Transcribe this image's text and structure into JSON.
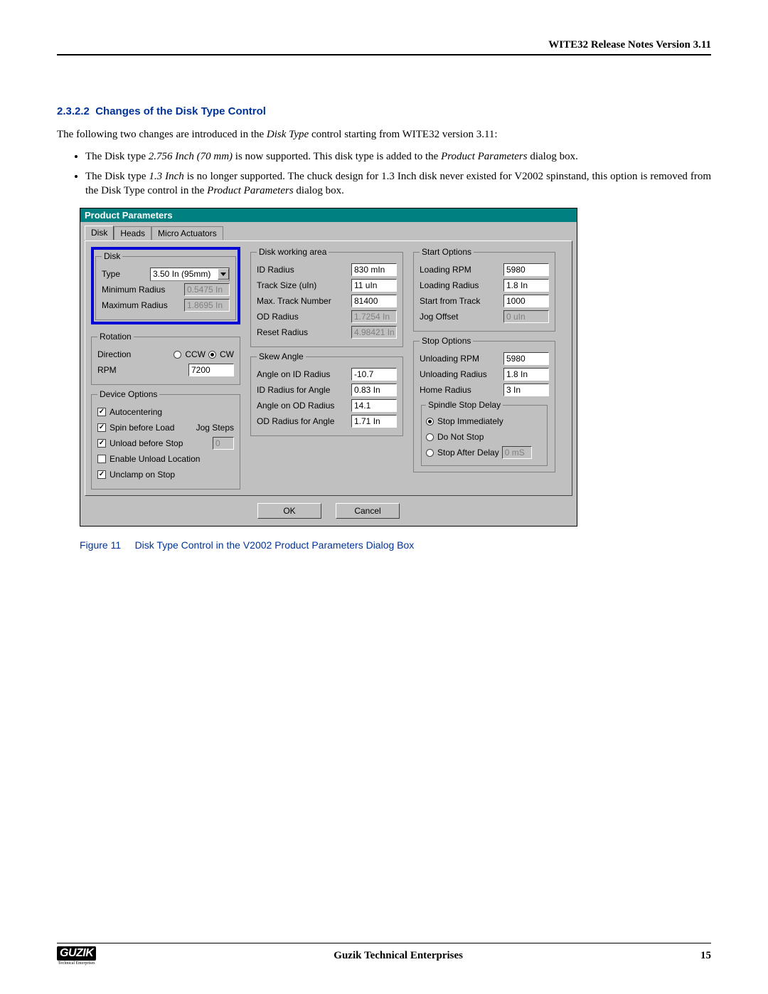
{
  "header": {
    "title": "WITE32 Release Notes Version 3.11"
  },
  "section": {
    "number": "2.3.2.2",
    "title": "Changes of the Disk Type Control",
    "intro_pre": "The following two changes are introduced in the ",
    "intro_em": "Disk Type",
    "intro_post": " control starting from WITE32 version 3.11:",
    "bullet1_a": "The Disk type ",
    "bullet1_em": "2.756 Inch (70 mm)",
    "bullet1_b": " is now supported. This disk type is added to the ",
    "bullet1_em2": "Product Parameters",
    "bullet1_c": " dialog box.",
    "bullet2_a": "The Disk type ",
    "bullet2_em": "1.3 Inch",
    "bullet2_b": " is no longer supported. The chuck design for 1.3 Inch disk never existed for V2002 spinstand, this option is removed from the Disk Type control in the ",
    "bullet2_em2": "Product Parameters",
    "bullet2_c": " dialog box."
  },
  "dialog": {
    "title": "Product Parameters",
    "tabs": {
      "t0": "Disk",
      "t1": "Heads",
      "t2": "Micro Actuators"
    },
    "disk": {
      "legend": "Disk",
      "type_label": "Type",
      "type_value": "3.50 In (95mm)",
      "minr_label": "Minimum Radius",
      "minr_value": "0.5475 In",
      "maxr_label": "Maximum Radius",
      "maxr_value": "1.8695 In"
    },
    "rotation": {
      "legend": "Rotation",
      "dir_label": "Direction",
      "ccw": "CCW",
      "cw": "CW",
      "rpm_label": "RPM",
      "rpm_value": "7200"
    },
    "devopt": {
      "legend": "Device Options",
      "autocenter": "Autocentering",
      "spin": "Spin before Load",
      "unload": "Unload before Stop",
      "enable_unload": "Enable Unload Location",
      "unclamp": "Unclamp on Stop",
      "jog_label": "Jog Steps",
      "jog_value": "0"
    },
    "work": {
      "legend": "Disk working area",
      "idr_label": "ID Radius",
      "idr_value": "830 mIn",
      "ts_label": "Track Size (uIn)",
      "ts_value": "11 uIn",
      "mtn_label": "Max. Track Number",
      "mtn_value": "81400",
      "odr_label": "OD Radius",
      "odr_value": "1.7254 In",
      "rr_label": "Reset Radius",
      "rr_value": "4.98421 In"
    },
    "skew": {
      "legend": "Skew Angle",
      "aid_label": "Angle on ID Radius",
      "aid_value": "-10.7",
      "idra_label": "ID Radius for Angle",
      "idra_value": "0.83 In",
      "aod_label": "Angle on OD Radius",
      "aod_value": "14.1",
      "odra_label": "OD Radius for Angle",
      "odra_value": "1.71 In"
    },
    "start": {
      "legend": "Start Options",
      "lrpm_label": "Loading RPM",
      "lrpm_value": "5980",
      "lrad_label": "Loading Radius",
      "lrad_value": "1.8 In",
      "sft_label": "Start from Track",
      "sft_value": "1000",
      "jo_label": "Jog Offset",
      "jo_value": "0 uIn"
    },
    "stop": {
      "legend": "Stop Options",
      "urpm_label": "Unloading RPM",
      "urpm_value": "5980",
      "urad_label": "Unloading Radius",
      "urad_value": "1.8 In",
      "hr_label": "Home Radius",
      "hr_value": "3 In",
      "delay_legend": "Spindle Stop Delay",
      "stop_imm": "Stop Immediately",
      "no_stop": "Do Not Stop",
      "stop_after": "Stop After Delay",
      "stop_after_value": "0 mS"
    },
    "buttons": {
      "ok": "OK",
      "cancel": "Cancel"
    }
  },
  "figure": {
    "label": "Figure 11",
    "caption": "Disk Type Control in the V2002 Product Parameters Dialog Box"
  },
  "footer": {
    "logo": "GUZIK",
    "logo_sub": "Technical Enterprises",
    "center": "Guzik Technical Enterprises",
    "page": "15"
  }
}
